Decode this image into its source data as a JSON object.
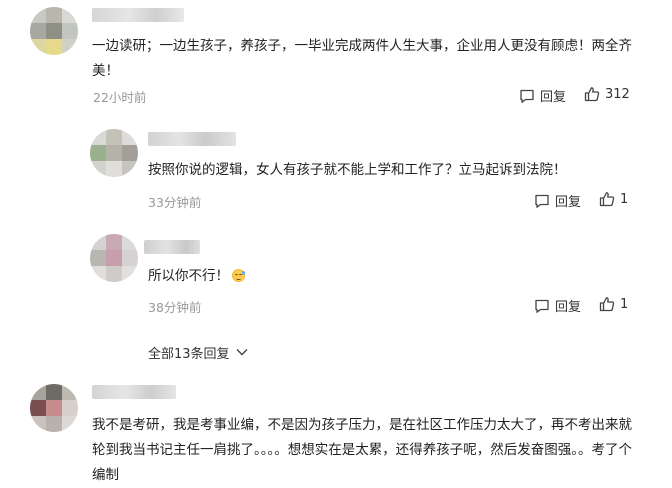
{
  "comments": [
    {
      "text": "一边读研；一边生孩子，养孩子，一毕业完成两件人生大事，企业用人更没有顾虑！两全齐美！",
      "time": "22小时前",
      "reply_label": "回复",
      "likes": "312"
    }
  ],
  "replies": [
    {
      "text": "按照你说的逻辑，女人有孩子就不能上学和工作了？立马起诉到法院！",
      "time": "33分钟前",
      "reply_label": "回复",
      "likes": "1"
    },
    {
      "text": "所以你不行！",
      "emoji": "crying-laughing-emoji",
      "time": "38分钟前",
      "reply_label": "回复",
      "likes": "1"
    }
  ],
  "expand_replies": "全部13条回复",
  "second_comment": {
    "text": "我不是考研，我是考事业编，不是因为孩子压力，是在社区工作压力太大了，再不考出来就轮到我当书记主任一肩挑了。。。。想想实在是太累，还得养孩子呢，然后发奋图强。。考了个编制"
  },
  "icons": {
    "reply": "comment-bubble-icon",
    "like": "thumbs-up-icon",
    "expand": "chevron-down-icon"
  },
  "colors": {
    "text": "#222222",
    "meta": "#999999",
    "action": "#333333"
  }
}
